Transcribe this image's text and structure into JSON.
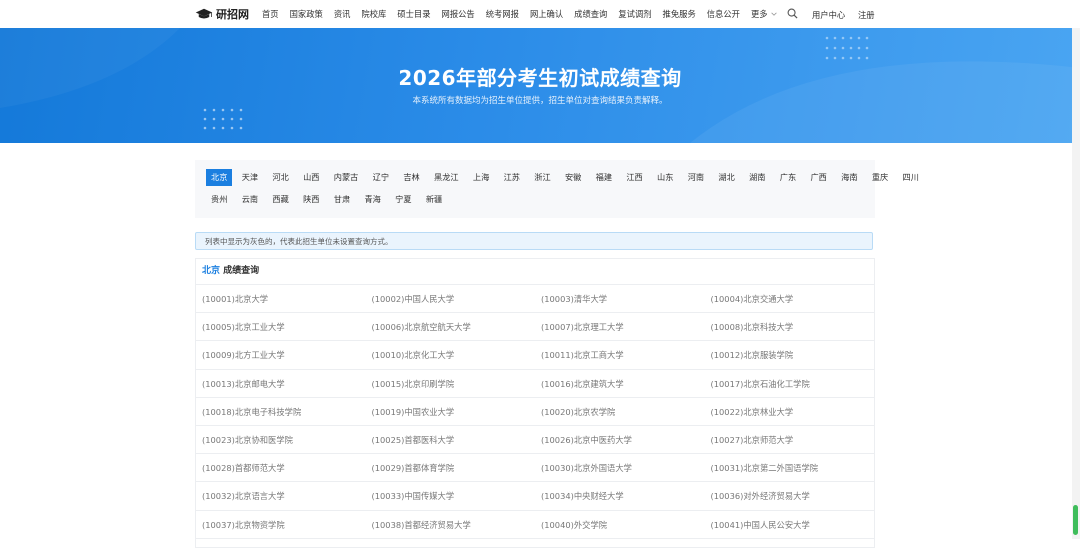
{
  "nav": {
    "logo_text": "研招网",
    "items": [
      "首页",
      "国家政策",
      "资讯",
      "院校库",
      "硕士目录",
      "网报公告",
      "统考网报",
      "网上确认",
      "成绩查询",
      "复试调剂",
      "推免服务",
      "信息公开"
    ],
    "more_label": "更多",
    "user_center": "用户中心",
    "register": "注册"
  },
  "banner": {
    "title": "2026年部分考生初试成绩查询",
    "subtitle": "本系统所有数据均为招生单位提供，招生单位对查询结果负责解释。"
  },
  "provinces": {
    "selected": "北京",
    "row1": [
      "北京",
      "天津",
      "河北",
      "山西",
      "内蒙古",
      "辽宁",
      "吉林",
      "黑龙江",
      "上海",
      "江苏",
      "浙江",
      "安徽",
      "福建",
      "江西",
      "山东",
      "河南",
      "湖北",
      "湖南",
      "广东",
      "广西",
      "海南",
      "重庆",
      "四川"
    ],
    "row2": [
      "贵州",
      "云南",
      "西藏",
      "陕西",
      "甘肃",
      "青海",
      "宁夏",
      "新疆"
    ]
  },
  "notice": "列表中显示为灰色的，代表此招生单位未设置查询方式。",
  "results": {
    "province": "北京",
    "heading_suffix": " 成绩查询",
    "rows": [
      [
        "(10001)北京大学",
        "(10002)中国人民大学",
        "(10003)清华大学",
        "(10004)北京交通大学"
      ],
      [
        "(10005)北京工业大学",
        "(10006)北京航空航天大学",
        "(10007)北京理工大学",
        "(10008)北京科技大学"
      ],
      [
        "(10009)北方工业大学",
        "(10010)北京化工大学",
        "(10011)北京工商大学",
        "(10012)北京服装学院"
      ],
      [
        "(10013)北京邮电大学",
        "(10015)北京印刷学院",
        "(10016)北京建筑大学",
        "(10017)北京石油化工学院"
      ],
      [
        "(10018)北京电子科技学院",
        "(10019)中国农业大学",
        "(10020)北京农学院",
        "(10022)北京林业大学"
      ],
      [
        "(10023)北京协和医学院",
        "(10025)首都医科大学",
        "(10026)北京中医药大学",
        "(10027)北京师范大学"
      ],
      [
        "(10028)首都师范大学",
        "(10029)首都体育学院",
        "(10030)北京外国语大学",
        "(10031)北京第二外国语学院"
      ],
      [
        "(10032)北京语言大学",
        "(10033)中国传媒大学",
        "(10034)中央财经大学",
        "(10036)对外经济贸易大学"
      ],
      [
        "(10037)北京物资学院",
        "(10038)首都经济贸易大学",
        "(10040)外交学院",
        "(10041)中国人民公安大学"
      ]
    ]
  },
  "colors": {
    "accent": "#1b7fe0",
    "banner_start": "#1479d9",
    "banner_end": "#4aa5f2",
    "scroll_thumb": "#3fbd5b"
  },
  "icons": {
    "logo": "graduation-cap-icon",
    "search": "search-icon",
    "more": "chevron-down-icon"
  }
}
